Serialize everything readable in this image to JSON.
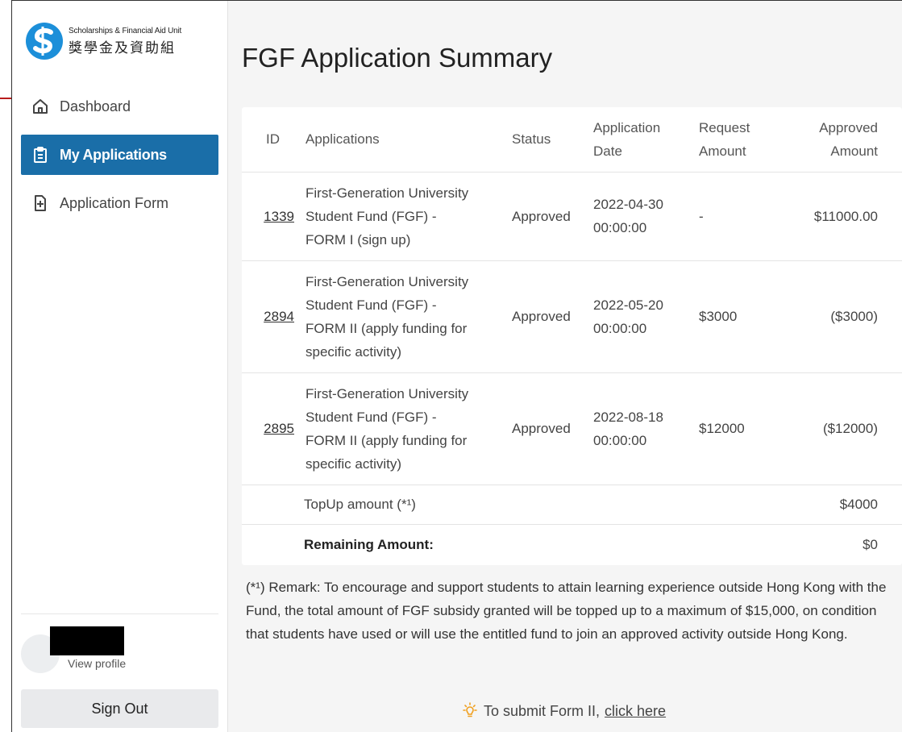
{
  "logo": {
    "en": "Scholarships & Financial Aid Unit",
    "zh": "獎學金及資助組"
  },
  "nav": {
    "items": [
      {
        "label": "Dashboard",
        "icon": "home-icon"
      },
      {
        "label": "My Applications",
        "icon": "clipboard-icon",
        "active": true
      },
      {
        "label": "Application Form",
        "icon": "add-document-icon"
      }
    ]
  },
  "profile": {
    "view_label": "View profile"
  },
  "signout_label": "Sign Out",
  "page_title": "FGF Application Summary",
  "table": {
    "headers": {
      "id": "ID",
      "applications": "Applications",
      "status": "Status",
      "date": [
        "Application",
        "Date"
      ],
      "request": [
        "Request",
        "Amount"
      ],
      "approved": [
        "Approved",
        "Amount"
      ]
    },
    "rows": [
      {
        "id": "1339",
        "application": [
          "First-Generation University",
          "Student Fund (FGF) -",
          "FORM I (sign up)"
        ],
        "status": "Approved",
        "date": [
          "2022-04-30",
          "00:00:00"
        ],
        "request": "-",
        "approved": "$11000.00"
      },
      {
        "id": "2894",
        "application": [
          "First-Generation University",
          "Student Fund (FGF) -",
          "FORM II (apply funding for",
          "specific activity)"
        ],
        "status": "Approved",
        "date": [
          "2022-05-20",
          "00:00:00"
        ],
        "request": "$3000",
        "approved": "($3000)"
      },
      {
        "id": "2895",
        "application": [
          "First-Generation University",
          "Student Fund (FGF) -",
          "FORM II (apply funding for",
          "specific activity)"
        ],
        "status": "Approved",
        "date": [
          "2022-08-18",
          "00:00:00"
        ],
        "request": "$12000",
        "approved": "($12000)"
      }
    ],
    "topup": {
      "label": "TopUp amount (*¹)",
      "value": "$4000"
    },
    "remaining": {
      "label": "Remaining Amount:",
      "value": "$0"
    }
  },
  "remark": "(*¹) Remark: To encourage and support students to attain learning experience outside Hong Kong with the Fund, the total amount of FGF subsidy granted will be topped up to a maximum of $15,000, on condition that students have used or will use the entitled fund to join an approved activity outside Hong Kong.",
  "submit": {
    "text": "To submit Form II,",
    "link": "click here",
    "icon": "lightbulb-icon"
  },
  "colors": {
    "accent": "#1a6ea8",
    "logo": "#1c8fd9",
    "annotation_arrow": "#b81c1c",
    "bulb": "#f0a020"
  }
}
